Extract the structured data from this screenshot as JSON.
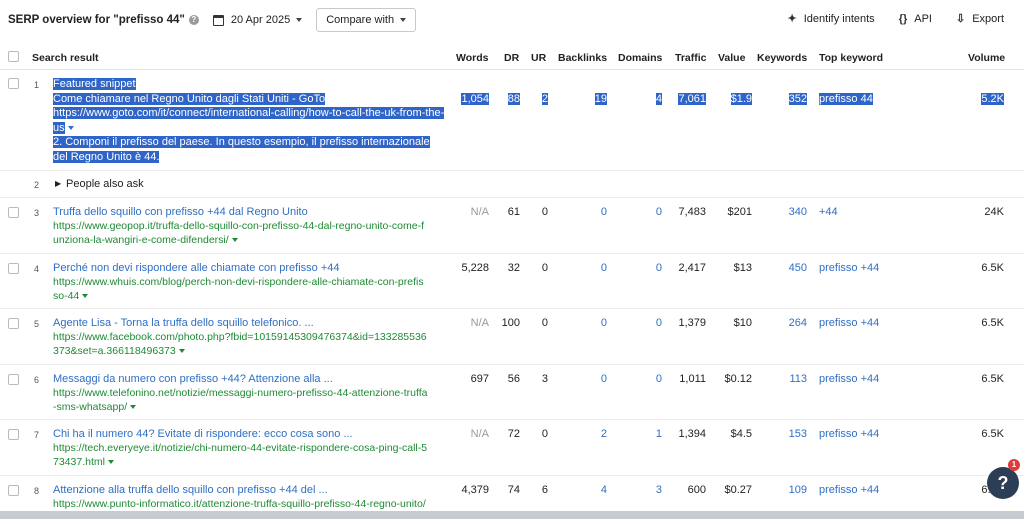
{
  "header": {
    "title": "SERP overview for \"prefisso 44\"",
    "date": "20 Apr 2025",
    "compare_label": "Compare with",
    "identify_label": "Identify intents",
    "api_label": "API",
    "export_label": "Export"
  },
  "columns": {
    "search_result": "Search result",
    "words": "Words",
    "dr": "DR",
    "ur": "UR",
    "backlinks": "Backlinks",
    "domains": "Domains",
    "traffic": "Traffic",
    "value": "Value",
    "keywords": "Keywords",
    "top_keyword": "Top keyword",
    "volume": "Volume"
  },
  "featured": {
    "idx": "1",
    "label": "Featured snippet",
    "title": "Come chiamare nel Regno Unito dagli Stati Uniti - GoTo",
    "url1": "https://www.goto.com/it/connect/international-calling/how-to-call-the-uk-from-the-",
    "url2": "us",
    "snippet1": "2. Componi il prefisso del paese. In questo esempio, il prefisso internazionale",
    "snippet2": "del Regno Unito è 44.",
    "words": "1,054",
    "dr": "88",
    "ur": "2",
    "backlinks": "19",
    "domains": "4",
    "traffic": "7,061",
    "value": "$1.9",
    "keywords": "352",
    "top_keyword": "prefisso 44",
    "volume": "5.2K"
  },
  "paa": {
    "idx": "2",
    "label": "People also ask"
  },
  "rows": [
    {
      "idx": "3",
      "title": "Truffa dello squillo con prefisso +44 dal Regno Unito",
      "url1": "https://www.geopop.it/truffa-dello-squillo-con-prefisso-44-dal-regno-unito-come-f",
      "url2": "unziona-la-wangiri-e-come-difendersi/",
      "words": "N/A",
      "dr": "61",
      "ur": "0",
      "backlinks": "0",
      "domains": "0",
      "traffic": "7,483",
      "value": "$201",
      "keywords": "340",
      "top_keyword": "+44",
      "volume": "24K"
    },
    {
      "idx": "4",
      "title": "Perché non devi rispondere alle chiamate con prefisso +44",
      "url1": "https://www.whuis.com/blog/perch-non-devi-rispondere-alle-chiamate-con-prefis",
      "url2": "so-44",
      "words": "5,228",
      "dr": "32",
      "ur": "0",
      "backlinks": "0",
      "domains": "0",
      "traffic": "2,417",
      "value": "$13",
      "keywords": "450",
      "top_keyword": "prefisso +44",
      "volume": "6.5K"
    },
    {
      "idx": "5",
      "title": "Agente Lisa - Torna la truffa dello squillo telefonico. ...",
      "url1": "https://www.facebook.com/photo.php?fbid=10159145309476374&id=133285536",
      "url2": "373&set=a.366118496373",
      "words": "N/A",
      "dr": "100",
      "ur": "0",
      "backlinks": "0",
      "domains": "0",
      "traffic": "1,379",
      "value": "$10",
      "keywords": "264",
      "top_keyword": "prefisso +44",
      "volume": "6.5K"
    },
    {
      "idx": "6",
      "title": "Messaggi da numero con prefisso +44? Attenzione alla ...",
      "url1": "https://www.telefonino.net/notizie/messaggi-numero-prefisso-44-attenzione-truffa",
      "url2": "-sms-whatsapp/",
      "words": "697",
      "dr": "56",
      "ur": "3",
      "backlinks": "0",
      "domains": "0",
      "traffic": "1,011",
      "value": "$0.12",
      "keywords": "113",
      "top_keyword": "prefisso +44",
      "volume": "6.5K"
    },
    {
      "idx": "7",
      "title": "Chi ha il numero 44? Evitate di rispondere: ecco cosa sono ...",
      "url1": "https://tech.everyeye.it/notizie/chi-numero-44-evitate-rispondere-cosa-ping-call-5",
      "url2": "73437.html",
      "words": "N/A",
      "dr": "72",
      "ur": "0",
      "backlinks": "2",
      "domains": "1",
      "traffic": "1,394",
      "value": "$4.5",
      "keywords": "153",
      "top_keyword": "prefisso +44",
      "volume": "6.5K"
    },
    {
      "idx": "8",
      "title": "Attenzione alla truffa dello squillo con prefisso +44 del ...",
      "url1": "https://www.punto-informatico.it/attenzione-truffa-squillo-prefisso-44-regno-unito/",
      "url2": "",
      "words": "4,379",
      "dr": "74",
      "ur": "6",
      "backlinks": "4",
      "domains": "3",
      "traffic": "600",
      "value": "$0.27",
      "keywords": "109",
      "top_keyword": "prefisso +44",
      "volume": "6.5K"
    }
  ],
  "help": {
    "icon": "?",
    "badge": "1"
  }
}
